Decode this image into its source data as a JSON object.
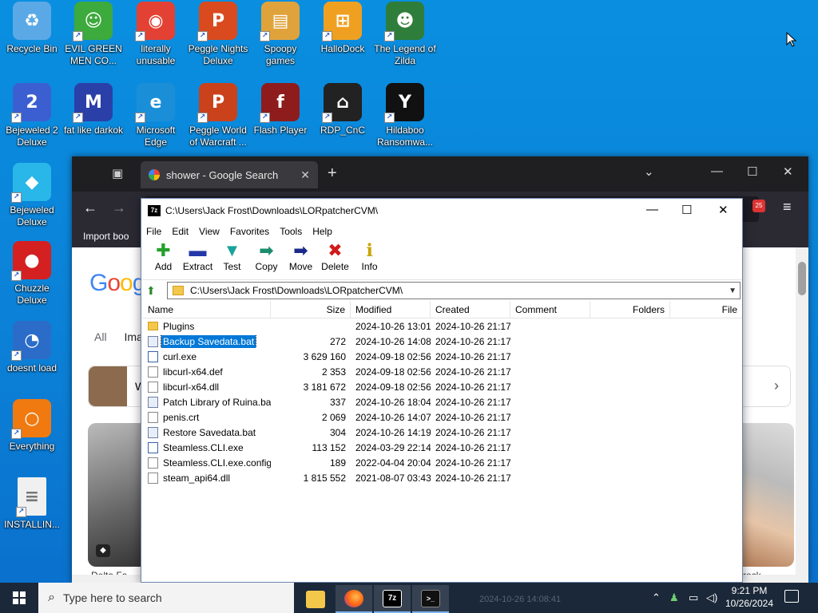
{
  "desktop": {
    "icons": [
      {
        "label": "Recycle Bin",
        "glyph": "♻",
        "color": "#5aa9e6",
        "icon": "recycle-bin-icon"
      },
      {
        "label": "EVIL GREEN MEN CO...",
        "glyph": "☺",
        "color": "#3caa3c",
        "icon": "green-men-icon"
      },
      {
        "label": "literally unusable",
        "glyph": "◉",
        "color": "#e34133",
        "icon": "chrome-icon"
      },
      {
        "label": "Peggle Nights Deluxe",
        "glyph": "P",
        "color": "#d94b1e",
        "icon": "peggle-icon"
      },
      {
        "label": "Spoopy games",
        "glyph": "▤",
        "color": "#e0a33c",
        "icon": "folder-icon"
      },
      {
        "label": "HalloDock",
        "glyph": "⊞",
        "color": "#f0a020",
        "icon": "shield-icon"
      },
      {
        "label": "The Legend of Zilda",
        "glyph": "☻",
        "color": "#2f7d3a",
        "icon": "zilda-icon"
      },
      {
        "label": "Bejeweled 2 Deluxe",
        "glyph": "2",
        "color": "#3b5fd1",
        "icon": "bejeweled2-icon"
      },
      {
        "label": "fat like darkok",
        "glyph": "M",
        "color": "#2b3fa8",
        "icon": "mpl-icon"
      },
      {
        "label": "Microsoft Edge",
        "glyph": "e",
        "color": "#1a8fd8",
        "icon": "edge-icon"
      },
      {
        "label": "Peggle World of Warcraft ...",
        "glyph": "P",
        "color": "#c9421c",
        "icon": "peggle-wow-icon"
      },
      {
        "label": "Flash Player",
        "glyph": "f",
        "color": "#8e1c1c",
        "icon": "flash-icon"
      },
      {
        "label": "RDP_CnC",
        "glyph": "⌂",
        "color": "#222222",
        "icon": "rdp-icon"
      },
      {
        "label": "Hildaboo Ransomwa...",
        "glyph": "Y",
        "color": "#111111",
        "icon": "ransomware-icon"
      },
      {
        "label": "Bejeweled Deluxe",
        "glyph": "◆",
        "color": "#29b6e8",
        "icon": "bejeweled-icon"
      },
      {
        "label": "Chuzzle Deluxe",
        "glyph": "●",
        "color": "#d42020",
        "icon": "chuzzle-icon"
      },
      {
        "label": "doesnt load",
        "glyph": "◔",
        "color": "#2b6cc9",
        "icon": "thunderbird-icon"
      },
      {
        "label": "Everything",
        "glyph": "○",
        "color": "#f07a10",
        "icon": "everything-icon"
      },
      {
        "label": "INSTALLIN...",
        "glyph": "≡",
        "color": "#f0f0f0",
        "icon": "text-file-icon"
      }
    ]
  },
  "browser": {
    "tab_title": "shower - Google Search",
    "bookmark_label": "Import boo",
    "ext_badge": "25",
    "google_logo": "Goog",
    "tabs": [
      "All",
      "Ima"
    ],
    "card_text": "W",
    "caption_left": "Delta Fa",
    "caption_right": "rock"
  },
  "zip": {
    "title": "C:\\Users\\Jack Frost\\Downloads\\LORpatcherCVM\\",
    "app_icon_text": "7z",
    "menu": [
      "File",
      "Edit",
      "View",
      "Favorites",
      "Tools",
      "Help"
    ],
    "toolbar": [
      {
        "label": "Add",
        "glyph": "✚",
        "color": "#27a02b",
        "icon": "add-icon"
      },
      {
        "label": "Extract",
        "glyph": "▬",
        "color": "#2338a8",
        "icon": "extract-icon"
      },
      {
        "label": "Test",
        "glyph": "▼",
        "color": "#19a39a",
        "icon": "test-icon"
      },
      {
        "label": "Copy",
        "glyph": "➡",
        "color": "#1d8c6e",
        "icon": "copy-icon"
      },
      {
        "label": "Move",
        "glyph": "➡",
        "color": "#1b2a8a",
        "icon": "move-icon"
      },
      {
        "label": "Delete",
        "glyph": "✖",
        "color": "#d11a1a",
        "icon": "delete-icon"
      },
      {
        "label": "Info",
        "glyph": "ℹ",
        "color": "#c9a400",
        "icon": "info-icon"
      }
    ],
    "address": "C:\\Users\\Jack Frost\\Downloads\\LORpatcherCVM\\",
    "columns": {
      "name": "Name",
      "size": "Size",
      "modified": "Modified",
      "created": "Created",
      "comment": "Comment",
      "folders": "Folders",
      "files": "File"
    },
    "files": [
      {
        "name": "Plugins",
        "size": "",
        "modified": "2024-10-26 13:01",
        "created": "2024-10-26 21:17",
        "kind": "folder"
      },
      {
        "name": "Backup Savedata.bat",
        "size": "272",
        "modified": "2024-10-26 14:08",
        "created": "2024-10-26 21:17",
        "kind": "bat",
        "selected": true
      },
      {
        "name": "curl.exe",
        "size": "3 629 160",
        "modified": "2024-09-18 02:56",
        "created": "2024-10-26 21:17",
        "kind": "exe"
      },
      {
        "name": "libcurl-x64.def",
        "size": "2 353",
        "modified": "2024-09-18 02:56",
        "created": "2024-10-26 21:17",
        "kind": "file"
      },
      {
        "name": "libcurl-x64.dll",
        "size": "3 181 672",
        "modified": "2024-09-18 02:56",
        "created": "2024-10-26 21:17",
        "kind": "dll"
      },
      {
        "name": "Patch Library of Ruina.bat",
        "size": "337",
        "modified": "2024-10-26 18:04",
        "created": "2024-10-26 21:17",
        "kind": "bat"
      },
      {
        "name": "penis.crt",
        "size": "2 069",
        "modified": "2024-10-26 14:07",
        "created": "2024-10-26 21:17",
        "kind": "crt"
      },
      {
        "name": "Restore Savedata.bat",
        "size": "304",
        "modified": "2024-10-26 14:19",
        "created": "2024-10-26 21:17",
        "kind": "bat"
      },
      {
        "name": "Steamless.CLI.exe",
        "size": "113 152",
        "modified": "2024-03-29 22:14",
        "created": "2024-10-26 21:17",
        "kind": "exe"
      },
      {
        "name": "Steamless.CLI.exe.config",
        "size": "189",
        "modified": "2022-04-04 20:04",
        "created": "2024-10-26 21:17",
        "kind": "file"
      },
      {
        "name": "steam_api64.dll",
        "size": "1 815 552",
        "modified": "2021-08-07 03:43",
        "created": "2024-10-26 21:17",
        "kind": "dll"
      }
    ]
  },
  "taskbar": {
    "search_placeholder": "Type here to search",
    "ghost_text": "2024-10-26 14:08:41",
    "time": "9:21 PM",
    "date": "10/26/2024"
  }
}
